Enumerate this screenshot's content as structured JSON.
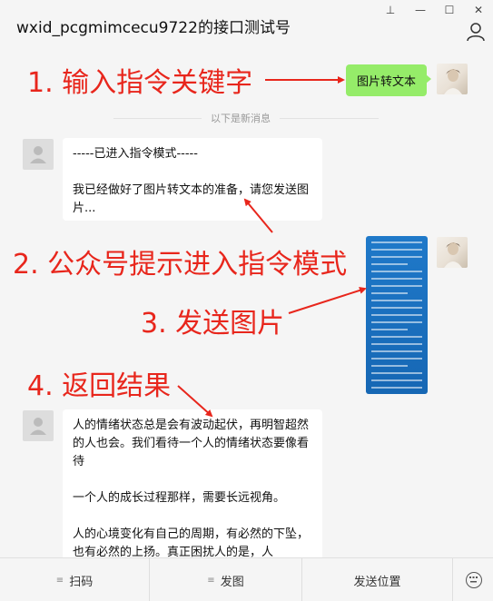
{
  "window": {
    "title": "wxid_pcgmimcecu9722的接口测试号",
    "controls": {
      "pin": "⊥",
      "minimize": "—",
      "maximize": "☐",
      "close": "✕"
    }
  },
  "chat": {
    "sent_text": "图片转文本",
    "separator": "以下是新消息",
    "reply1": {
      "line1": "-----已进入指令模式-----",
      "line2": "我已经做好了图片转文本的准备，请您发送图片..."
    },
    "reply2": {
      "p1": "人的情绪状态总是会有波动起伏，再明智超然的人也会。我们看待一个人的情绪状态要像看待",
      "p2": "一个人的成长过程那样，需要长远视角。",
      "p3": "人的心境变化有自己的周期，有必然的下坠，也有必然的上扬。真正困扰人的是，人"
    }
  },
  "annotations": {
    "a1": "1. 输入指令关键字",
    "a2": "2. 公众号提示进入指令模式",
    "a3": "3. 发送图片",
    "a4": "4. 返回结果"
  },
  "bottombar": {
    "scan": "扫码",
    "post": "发图",
    "send_location": "发送位置"
  },
  "colors": {
    "sent_bubble": "#95ec69",
    "annotation": "#e8261c",
    "image_blue": "#1a6fbf"
  }
}
